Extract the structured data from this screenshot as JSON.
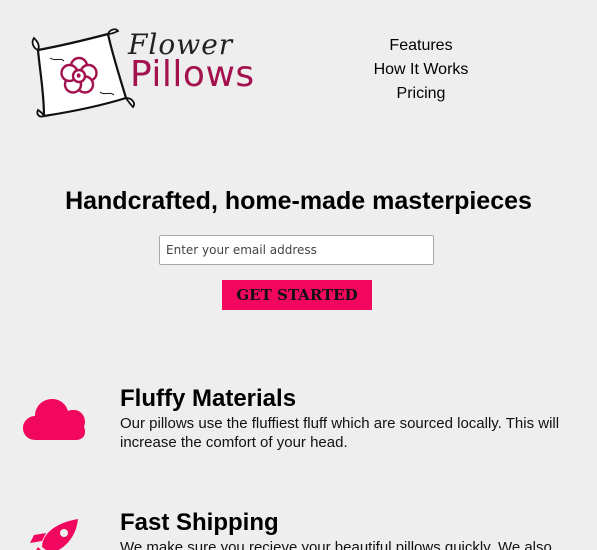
{
  "brand": {
    "word_top": "Flower",
    "word_main": "Pillows",
    "accent_color": "#a3114e"
  },
  "nav": {
    "items": [
      {
        "label": "Features"
      },
      {
        "label": "How It Works"
      },
      {
        "label": "Pricing"
      }
    ]
  },
  "hero": {
    "title": "Handcrafted, home-made masterpieces",
    "email_placeholder": "Enter your email address",
    "cta_label": "GET STARTED",
    "cta_color": "#f2075e"
  },
  "features": [
    {
      "icon": "cloud-icon",
      "title": "Fluffy Materials",
      "text": "Our pillows use the fluffiest fluff which are sourced locally. This will increase the comfort of your head."
    },
    {
      "icon": "rocket-icon",
      "title": "Fast Shipping",
      "text": "We make sure you recieve your beautiful pillows quickly. We also"
    }
  ]
}
